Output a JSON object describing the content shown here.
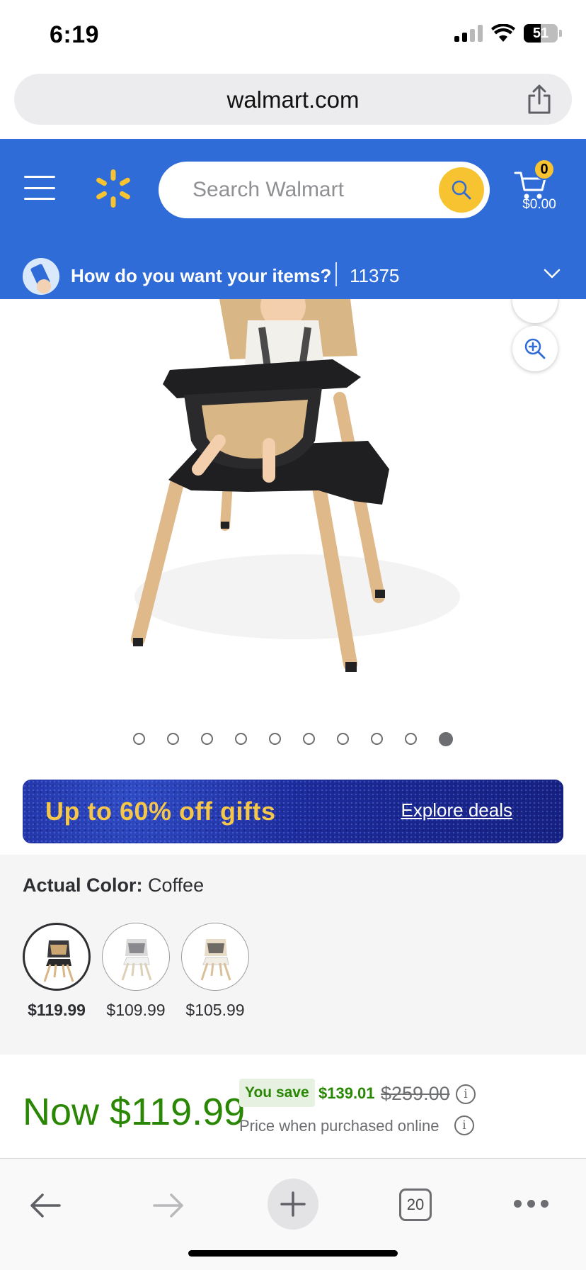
{
  "status_bar": {
    "time": "6:19",
    "battery": "51"
  },
  "browser": {
    "url": "walmart.com",
    "tab_count": "20"
  },
  "header": {
    "brand_color": "#2f6cd8",
    "spark_color": "#f7c331",
    "search_placeholder": "Search Walmart",
    "cart_count": "0",
    "cart_total": "$0.00",
    "delivery_prompt": "How do you want your items?",
    "zip": "11375"
  },
  "gallery": {
    "image_count": 10,
    "active_index": 9
  },
  "promo": {
    "title": "Up to 60% off gifts",
    "link": "Explore deals"
  },
  "variants": {
    "label": "Actual Color:",
    "selected_value": "Coffee",
    "options": [
      {
        "price": "$119.99",
        "selected": true
      },
      {
        "price": "$109.99",
        "selected": false
      },
      {
        "price": "$105.99",
        "selected": false
      }
    ]
  },
  "pricing": {
    "now_price": "Now $119.99",
    "you_save_label": "You save",
    "save_amount": "$139.01",
    "was_price": "$259.00",
    "online_note": "Price when purchased online",
    "info_glyph": "i"
  }
}
